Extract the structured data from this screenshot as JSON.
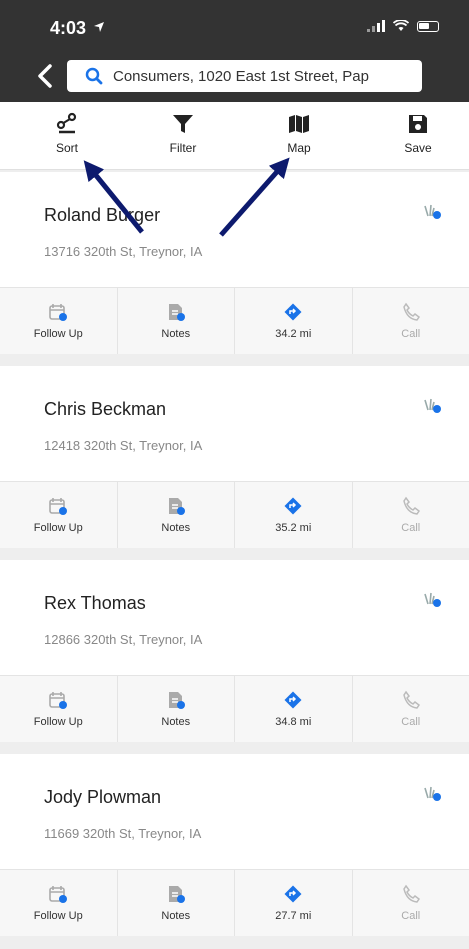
{
  "status_bar": {
    "time": "4:03"
  },
  "search": {
    "value": "Consumers, 1020 East 1st Street, Pap"
  },
  "toolbar": {
    "sort_label": "Sort",
    "filter_label": "Filter",
    "map_label": "Map",
    "save_label": "Save"
  },
  "actions": {
    "follow_up": "Follow Up",
    "notes": "Notes",
    "call": "Call"
  },
  "customers": [
    {
      "name": "Roland Burger",
      "address": "13716 320th St, Treynor, IA",
      "distance": "34.2 mi"
    },
    {
      "name": "Chris Beckman",
      "address": "12418 320th St, Treynor, IA",
      "distance": "35.2 mi"
    },
    {
      "name": "Rex Thomas",
      "address": "12866 320th St, Treynor, IA",
      "distance": "34.8 mi"
    },
    {
      "name": "Jody Plowman",
      "address": "11669 320th St, Treynor, IA",
      "distance": "27.7 mi"
    }
  ],
  "colors": {
    "header": "#333333",
    "accent": "#1a73e8",
    "arrow": "#0d1a6e"
  }
}
